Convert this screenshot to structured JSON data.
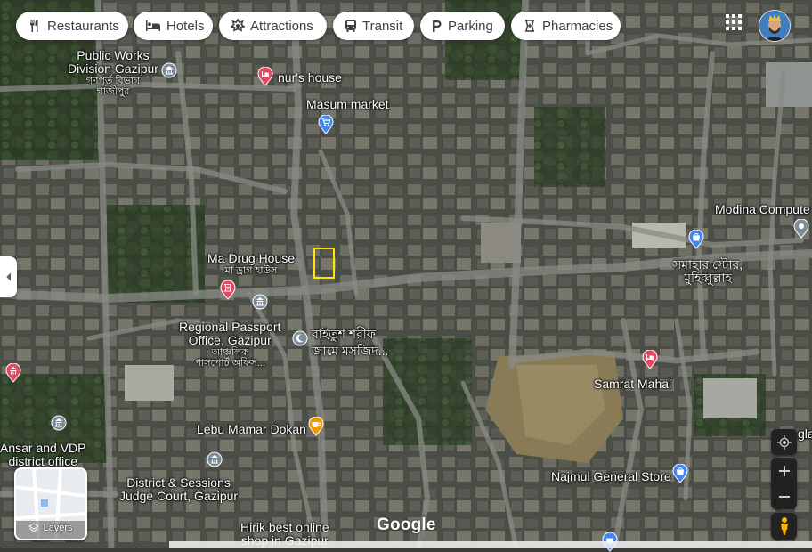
{
  "categories": [
    {
      "label": "Restaurants",
      "icon": "fork-knife-icon"
    },
    {
      "label": "Hotels",
      "icon": "bed-icon"
    },
    {
      "label": "Attractions",
      "icon": "camera-icon"
    },
    {
      "label": "Transit",
      "icon": "bus-icon"
    },
    {
      "label": "Parking",
      "icon": "parking-icon"
    },
    {
      "label": "Pharmacies",
      "icon": "pharmacy-icon"
    }
  ],
  "places": {
    "public_works_en_1": "Public Works",
    "public_works_en_2": "Division Gazipur",
    "public_works_bn_1": "গণপূর্ত বিভাগ",
    "public_works_bn_2": "গাজীপুর",
    "nurs_house": "nur's house",
    "masum_market": "Masum market",
    "modina": "Modina Compute",
    "ma_drug_en": "Ma Drug House",
    "ma_drug_bn": "মা ড্রাগ হাউস",
    "samahar_1": "সমাহার স্টোর,",
    "samahar_2": "মুহিব্বুল্লাহ",
    "passport_en_1": "Regional Passport",
    "passport_en_2": "Office, Gazipur",
    "passport_bn_1": "আঞ্চলিক",
    "passport_bn_2": "পাসপোর্ট অফিস...",
    "mosque_1": "বাইতুশ শরীফ",
    "mosque_2": "জামে মসজিদ...",
    "samrat": "Samrat Mahal",
    "ansar_1": "Ansar and VDP",
    "ansar_2": "district office",
    "lebu": "Lebu Mamar Dokan",
    "court_1": "District & Sessions",
    "court_2": "Judge Court, Gazipur",
    "najmul": "Najmul General Store",
    "hirik_1": "Hirik best online",
    "hirik_2": "shop in Gazipur",
    "right_edge": "gla"
  },
  "layers_label": "Layers",
  "brand": "Google",
  "colors": {
    "accent": "#1a73e8",
    "pin_red": "#e4495f",
    "pin_blue": "#4285f4",
    "pin_gray": "#7b8d9a",
    "pin_orange": "#f29900",
    "selection": "#ffe600"
  }
}
